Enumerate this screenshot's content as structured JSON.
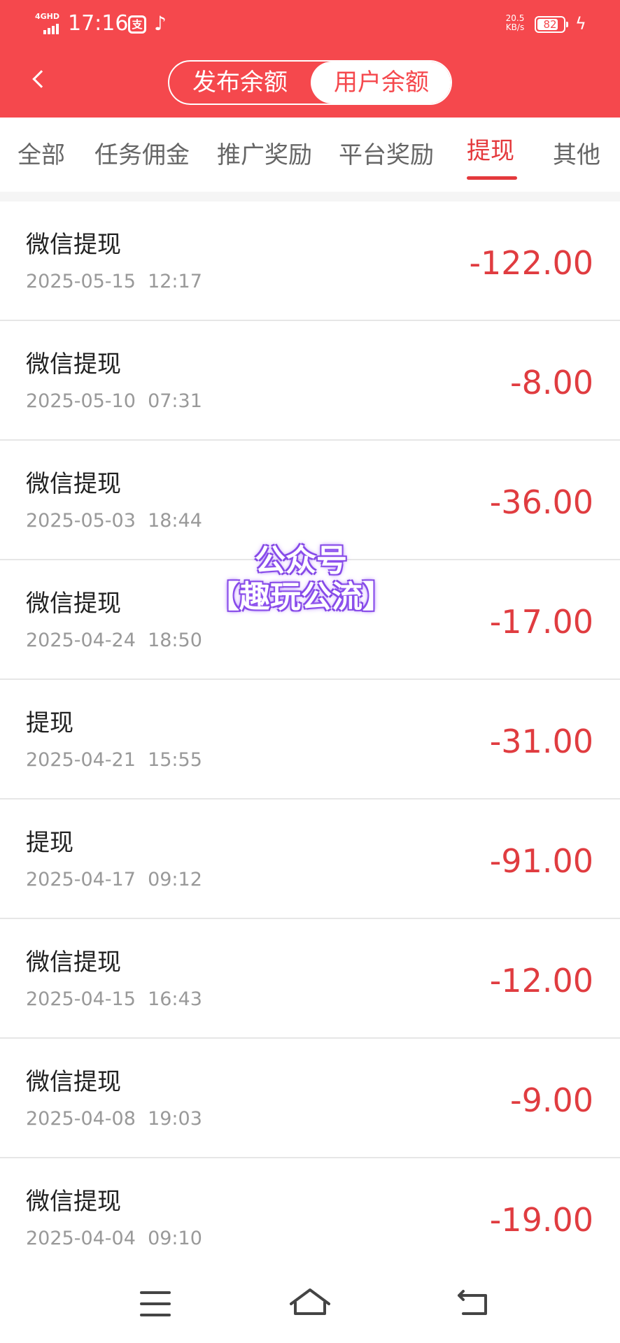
{
  "status_bar": {
    "network": "4GHD",
    "time": "17:16",
    "app_icon_1": "支",
    "app_icon_2": "tiktok-icon",
    "speed_value": "20.5",
    "speed_unit": "KB/s",
    "battery": "82",
    "battery_level": 0.82
  },
  "header": {
    "segment_left": "发布余额",
    "segment_right": "用户余额"
  },
  "tabs": [
    {
      "label": "全部"
    },
    {
      "label": "任务佣金"
    },
    {
      "label": "推广奖励"
    },
    {
      "label": "平台奖励"
    },
    {
      "label": "提现"
    },
    {
      "label": "其他"
    }
  ],
  "records": [
    {
      "title": "微信提现",
      "time": "2025-05-15  12:17",
      "amount": "-122.00"
    },
    {
      "title": "微信提现",
      "time": "2025-05-10  07:31",
      "amount": "-8.00"
    },
    {
      "title": "微信提现",
      "time": "2025-05-03  18:44",
      "amount": "-36.00"
    },
    {
      "title": "微信提现",
      "time": "2025-04-24  18:50",
      "amount": "-17.00"
    },
    {
      "title": "提现",
      "time": "2025-04-21  15:55",
      "amount": "-31.00"
    },
    {
      "title": "提现",
      "time": "2025-04-17  09:12",
      "amount": "-91.00"
    },
    {
      "title": "微信提现",
      "time": "2025-04-15  16:43",
      "amount": "-12.00"
    },
    {
      "title": "微信提现",
      "time": "2025-04-08  19:03",
      "amount": "-9.00"
    },
    {
      "title": "微信提现",
      "time": "2025-04-04  09:10",
      "amount": "-19.00"
    }
  ],
  "watermark": {
    "line1": "公众号",
    "line2": "【趣玩公流】"
  },
  "colors": {
    "header": "#f5484d",
    "accent": "#e4393c",
    "amount": "#e03c40"
  }
}
